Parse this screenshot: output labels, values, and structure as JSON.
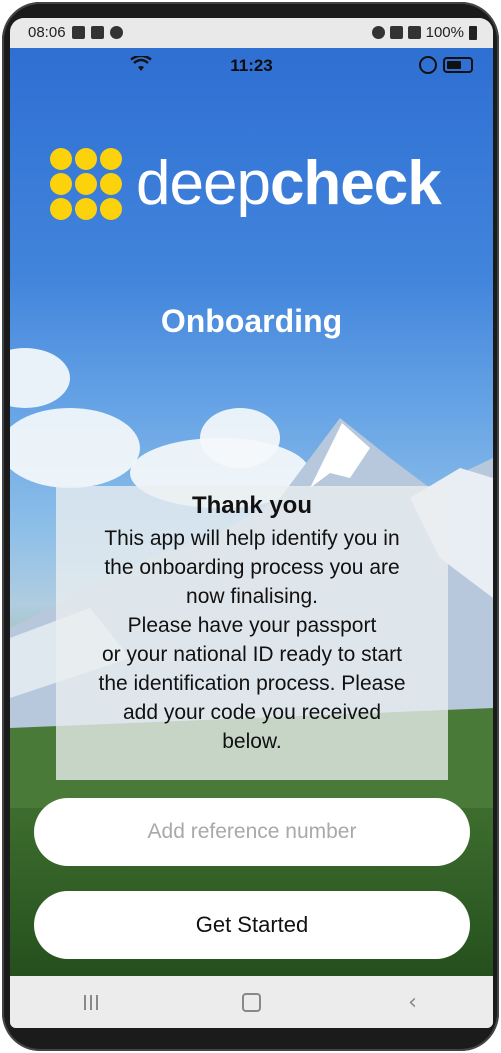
{
  "system_status": {
    "time": "08:06",
    "battery": "100%"
  },
  "app_status": {
    "time": "11:23"
  },
  "logo": {
    "light_text": "deep",
    "bold_text": "check",
    "dot_color": "#fcd20d"
  },
  "page": {
    "title": "Onboarding"
  },
  "card": {
    "title": "Thank you",
    "body": "This app will help identify you in\nthe onboarding process you are\nnow finalising.\nPlease have your passport\nor your national ID ready to start\nthe identification process. Please\nadd your code you received\nbelow."
  },
  "reference_input": {
    "placeholder": "Add reference number",
    "value": ""
  },
  "start_button": {
    "label": "Get Started"
  },
  "icons": {
    "wifi": "wifi-icon",
    "rotation_lock": "rotation-lock-icon",
    "battery": "battery-icon",
    "recents": "recents-icon",
    "home": "home-icon",
    "back": "back-icon"
  }
}
